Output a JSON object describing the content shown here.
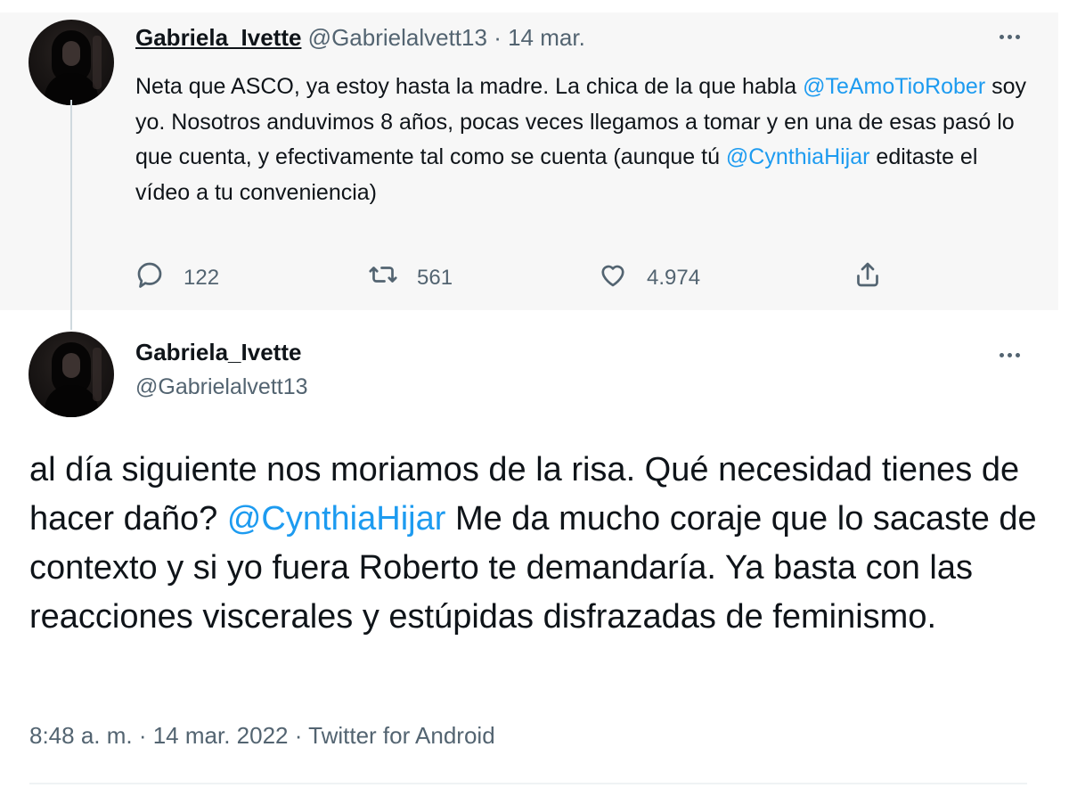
{
  "parent_tweet": {
    "display_name": "Gabriela_Ivette",
    "handle": "@Gabrielalvett13",
    "separator": "·",
    "date": "14 mar.",
    "text": {
      "part1": "Neta que ASCO, ya estoy hasta la madre. La chica de la que habla ",
      "mention1": "@TeAmoTioRober",
      "part2": " soy yo. Nosotros anduvimos 8 años, pocas veces llegamos a tomar y en una de esas pasó lo que cuenta, y efectivamente tal como se cuenta (aunque tú ",
      "mention2": "@CynthiaHijar",
      "part3": " editaste el vídeo a tu conveniencia)"
    },
    "replies": "122",
    "retweets": "561",
    "likes": "4.974"
  },
  "main_tweet": {
    "display_name": "Gabriela_Ivette",
    "handle": "@Gabrielalvett13",
    "text": {
      "part1": "al día siguiente nos moriamos de la risa. Qué necesidad tienes de hacer daño? ",
      "mention1": "@CynthiaHijar",
      "part2": "  Me da mucho coraje que lo sacaste de contexto y si yo fuera Roberto te demandaría. Ya basta con las reacciones viscerales y estúpidas disfrazadas de feminismo."
    },
    "meta": "8:48 a. m. · 14 mar. 2022 · Twitter for Android"
  },
  "icons": {
    "reply": "reply-icon",
    "retweet": "retweet-icon",
    "like": "heart-icon",
    "share": "share-icon",
    "more": "more-icon"
  },
  "colors": {
    "link": "#1d9bf0",
    "secondary_text": "#536471",
    "parent_background": "#f7f7f7"
  }
}
